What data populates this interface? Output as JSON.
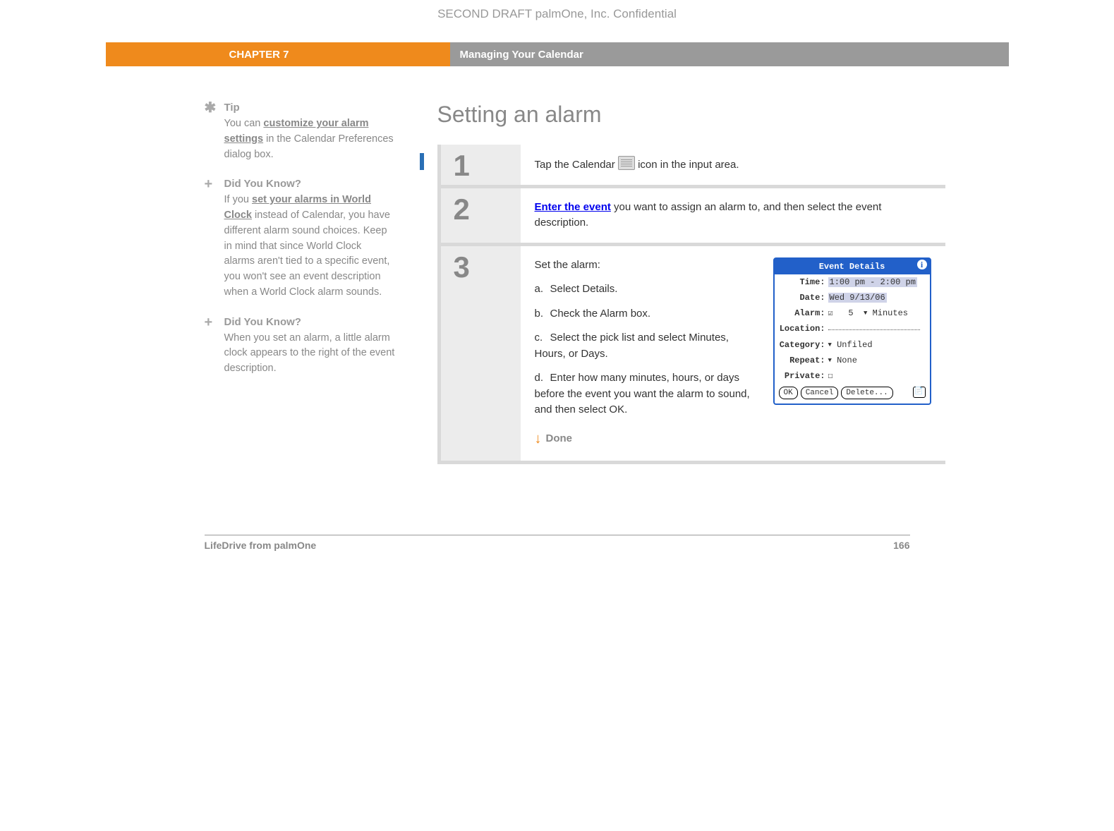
{
  "draft_header": "SECOND DRAFT palmOne, Inc.  Confidential",
  "banner": {
    "chapter": "CHAPTER 7",
    "title": "Managing Your Calendar"
  },
  "sidebar": {
    "tip": {
      "heading": "Tip",
      "pre": "You can ",
      "link": "customize your alarm settings",
      "post": " in the Calendar Preferences dialog box."
    },
    "dyk1": {
      "heading": "Did You Know?",
      "pre": "If you ",
      "link": "set your alarms in World Clock",
      "post": " instead of Calendar, you have different alarm sound choices. Keep in mind that since World Clock alarms aren't tied to a specific event, you won't see an event description when a World Clock alarm sounds."
    },
    "dyk2": {
      "heading": "Did You Know?",
      "text": "When you set an alarm, a little alarm clock appears to the right of the event description."
    }
  },
  "main": {
    "title": "Setting an alarm",
    "step1": {
      "num": "1",
      "pre": "Tap the Calendar ",
      "post": " icon in the input area."
    },
    "step2": {
      "num": "2",
      "link": "Enter the event",
      "post": " you want to assign an alarm to, and then select the event description."
    },
    "step3": {
      "num": "3",
      "intro": "Set the alarm:",
      "a": "Select Details.",
      "b": "Check the Alarm box.",
      "c": "Select the pick list and select Minutes, Hours, or Days.",
      "d": "Enter how many minutes, hours, or days before the event you want the alarm to sound, and then select OK.",
      "done": "Done"
    }
  },
  "dialog": {
    "title": "Event Details",
    "time_label": "Time:",
    "time_value": "1:00 pm - 2:00 pm",
    "date_label": "Date:",
    "date_value": "Wed 9/13/06",
    "alarm_label": "Alarm:",
    "alarm_value": "5",
    "alarm_unit": "Minutes",
    "location_label": "Location:",
    "category_label": "Category:",
    "category_value": "Unfiled",
    "repeat_label": "Repeat:",
    "repeat_value": "None",
    "private_label": "Private:",
    "ok": "OK",
    "cancel": "Cancel",
    "delete": "Delete..."
  },
  "footer": {
    "product": "LifeDrive from palmOne",
    "page": "166"
  }
}
